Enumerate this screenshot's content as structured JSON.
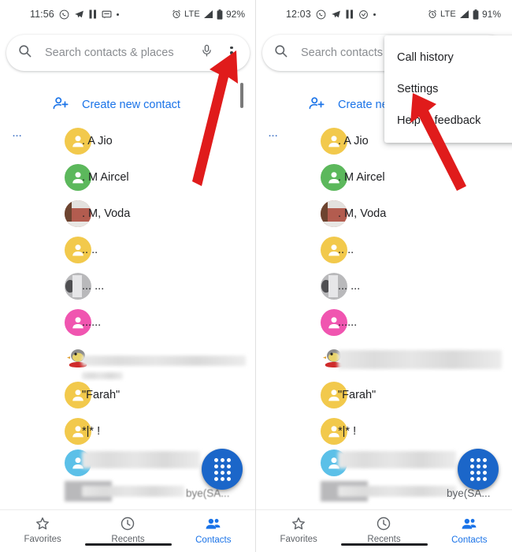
{
  "panels": [
    {
      "id": "left",
      "status": {
        "time": "11:56",
        "icons": [
          "whatsapp-icon",
          "telegram-icon",
          "pause-icon",
          "message-icon",
          "dot-icon"
        ],
        "alarm": "alarm-icon",
        "network": "LTE",
        "signal": "signal-icon",
        "battery_icon": "battery-icon",
        "battery": "92%"
      },
      "search": {
        "placeholder": "Search contacts & places",
        "search_icon": "search-icon",
        "mic_icon": "microphone-icon",
        "overflow_icon": "overflow-menu-icon"
      },
      "menu_open": false
    },
    {
      "id": "right",
      "status": {
        "time": "12:03",
        "icons": [
          "whatsapp-icon",
          "telegram-icon",
          "pause-icon",
          "clock-arrow-icon",
          "dot-icon"
        ],
        "alarm": "alarm-icon",
        "network": "LTE",
        "signal": "signal-icon",
        "battery_icon": "battery-icon",
        "battery": "91%"
      },
      "search": {
        "placeholder": "Search contacts &",
        "search_icon": "search-icon",
        "mic_icon": "microphone-icon",
        "overflow_icon": "overflow-menu-icon"
      },
      "menu_open": true
    }
  ],
  "overflow_menu": {
    "items": [
      {
        "label": "Call history"
      },
      {
        "label": "Settings"
      },
      {
        "label": "Help & feedback"
      }
    ]
  },
  "create_contact": {
    "label": "Create new contact",
    "icon": "person-add-icon"
  },
  "index_marker": "...",
  "contacts": [
    {
      "name": ". A Jio",
      "avatar_type": "letter",
      "color": "#f2c94c",
      "redacted": false
    },
    {
      "name": ". M Aircel",
      "avatar_type": "letter",
      "color": "#5cb85c",
      "redacted": false
    },
    {
      "name": ". M, Voda",
      "avatar_type": "photo-voda",
      "color": "#b35c4f",
      "redacted": false
    },
    {
      "name": ".. ..",
      "avatar_type": "letter",
      "color": "#f2c94c",
      "redacted": false
    },
    {
      "name": "... ...",
      "avatar_type": "photo-grey",
      "color": "#b9b9bb",
      "redacted": false
    },
    {
      "name": "......",
      "avatar_type": "letter",
      "color": "#f055b0",
      "redacted": false
    },
    {
      "name": "",
      "avatar_type": "photo-bird",
      "color": "#ffffff",
      "redacted": true,
      "blur_width": 208
    },
    {
      "name": "\"Farah\"",
      "avatar_type": "letter",
      "color": "#f2c94c",
      "redacted": false
    },
    {
      "name": "*|* !",
      "avatar_type": "letter",
      "color": "#f2c94c",
      "redacted": false
    },
    {
      "name": "",
      "avatar_type": "letter",
      "color": "#5bc0e8",
      "redacted": true,
      "blur_width": 150
    }
  ],
  "last_row": {
    "left_text": "",
    "right_text": "bye(SA...",
    "redacted": true
  },
  "fab": {
    "icon": "dialpad-icon",
    "color": "#1b66c9"
  },
  "bottom_nav": {
    "items": [
      {
        "label": "Favorites",
        "icon": "star-icon",
        "active": false
      },
      {
        "label": "Recents",
        "icon": "clock-icon",
        "active": false
      },
      {
        "label": "Contacts",
        "icon": "contacts-icon",
        "active": true
      }
    ]
  },
  "annotations": {
    "arrow_color": "#e01b1b",
    "arrows": [
      "arrow-to-overflow-menu",
      "arrow-to-settings"
    ]
  }
}
